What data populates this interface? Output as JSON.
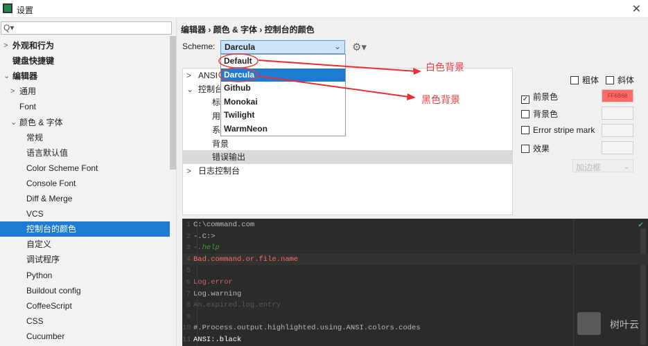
{
  "window": {
    "title": "设置",
    "close": "✕"
  },
  "search": {
    "icon": "search-icon",
    "value": "Q▾"
  },
  "sidebar": {
    "items": [
      {
        "label": "外观和行为",
        "arrow": ">",
        "level": 0,
        "bold": true
      },
      {
        "label": "键盘快捷键",
        "level": 0,
        "bold": true
      },
      {
        "label": "编辑器",
        "arrow": "⌄",
        "level": 0,
        "bold": true
      },
      {
        "label": "通用",
        "arrow": ">",
        "level": 1
      },
      {
        "label": "Font",
        "level": 1
      },
      {
        "label": "颜色 & 字体",
        "arrow": "⌄",
        "level": 1
      },
      {
        "label": "常规",
        "level": 2
      },
      {
        "label": "语言默认值",
        "level": 2
      },
      {
        "label": "Color Scheme Font",
        "level": 2
      },
      {
        "label": "Console Font",
        "level": 2
      },
      {
        "label": "Diff & Merge",
        "level": 2
      },
      {
        "label": "VCS",
        "level": 2
      },
      {
        "label": "控制台的颜色",
        "level": 2,
        "selected": true
      },
      {
        "label": "自定义",
        "level": 2
      },
      {
        "label": "调试程序",
        "level": 2
      },
      {
        "label": "Python",
        "level": 2
      },
      {
        "label": "Buildout config",
        "level": 2
      },
      {
        "label": "CoffeeScript",
        "level": 2
      },
      {
        "label": "CSS",
        "level": 2
      },
      {
        "label": "Cucumber",
        "level": 2
      }
    ]
  },
  "breadcrumb": "编辑器 › 颜色 & 字体 › 控制台的颜色",
  "scheme": {
    "label": "Scheme:",
    "value": "Darcula",
    "chevron": "⌄",
    "gear": "⚙▾",
    "options": [
      "Default",
      "Darcula",
      "Github",
      "Monokai",
      "Twilight",
      "WarmNeon"
    ],
    "selected": "Darcula"
  },
  "tree": {
    "rows": [
      {
        "label": "ANSI",
        "arrow": ">",
        "level": 0
      },
      {
        "label": "控制台",
        "arrow": "⌄",
        "level": 0
      },
      {
        "label": "标",
        "level": 1
      },
      {
        "label": "用",
        "level": 1
      },
      {
        "label": "系",
        "level": 1
      },
      {
        "label": "背景",
        "level": 1
      },
      {
        "label": "错误输出",
        "level": 1,
        "selected": true
      },
      {
        "label": "日志控制台",
        "arrow": ">",
        "level": 0
      }
    ]
  },
  "options": {
    "bold": "粗体",
    "italic": "斜体",
    "foreground": "前景色",
    "foreground_value": "FF6B68",
    "foreground_color": "#ff6b68",
    "background": "背景色",
    "error_stripe": "Error stripe mark",
    "effects": "效果",
    "effect_type": "加边框"
  },
  "editor": {
    "lines": [
      {
        "n": "1",
        "text": "C:\\command.com",
        "color": "#bbbbbb"
      },
      {
        "n": "2",
        "text": "-.C:>",
        "color": "#bbbbbb"
      },
      {
        "n": "3",
        "text": "-.help",
        "color": "#3f9c35",
        "italic": true
      },
      {
        "n": "4",
        "text": "Bad.command.or.file.name",
        "color": "#ff6b68"
      },
      {
        "n": "5",
        "text": "",
        "color": "#bbbbbb"
      },
      {
        "n": "6",
        "text": "Log.error",
        "color": "#cc666e"
      },
      {
        "n": "7",
        "text": "Log.warning",
        "color": "#bbbbbb"
      },
      {
        "n": "8",
        "text": "An.expired.log.entry",
        "color": "#5a5a5a"
      },
      {
        "n": "9",
        "text": "",
        "color": "#bbbbbb"
      },
      {
        "n": "10",
        "text": "#.Process.output.highlighted.using.ANSI.colors.codes",
        "color": "#bbbbbb"
      },
      {
        "n": "11",
        "text": "ANSI:.black",
        "color": "#ffffff"
      }
    ]
  },
  "annotations": {
    "white_bg": "白色背景",
    "black_bg": "黑色背景"
  },
  "watermark": "树叶云"
}
